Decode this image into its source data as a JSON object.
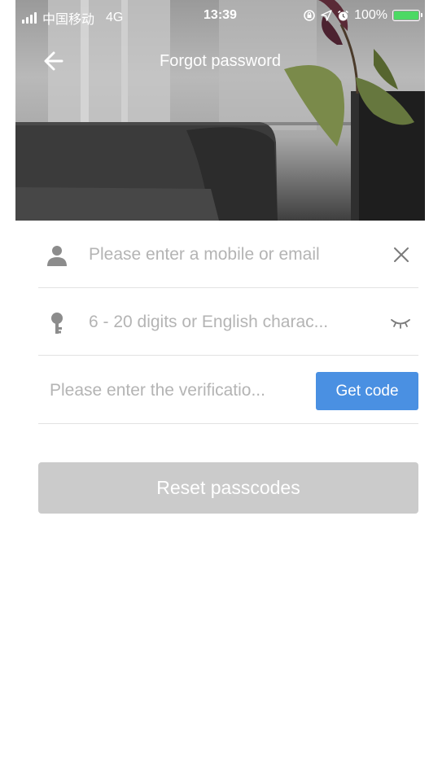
{
  "status_bar": {
    "carrier": "中国移动",
    "network": "4G",
    "time": "13:39",
    "battery": "100%",
    "battery_level": 1.0,
    "battery_color": "#4cd964"
  },
  "nav": {
    "title": "Forgot password",
    "back_icon": "arrow-left-icon"
  },
  "form": {
    "account": {
      "placeholder": "Please enter a mobile or email",
      "value": "",
      "icon": "user-icon",
      "action_icon": "close-icon"
    },
    "password": {
      "placeholder": "6 - 20 digits or English charac...",
      "value": "",
      "icon": "key-icon",
      "action_icon": "eye-closed-icon"
    },
    "code": {
      "placeholder": "Please enter the verificatio...",
      "value": "",
      "button_label": "Get code"
    },
    "submit_label": "Reset passcodes"
  },
  "colors": {
    "primary": "#4a90e2",
    "disabled": "#cbcbcb",
    "placeholder": "#b4b4b4",
    "divider": "#e2e2e2"
  }
}
